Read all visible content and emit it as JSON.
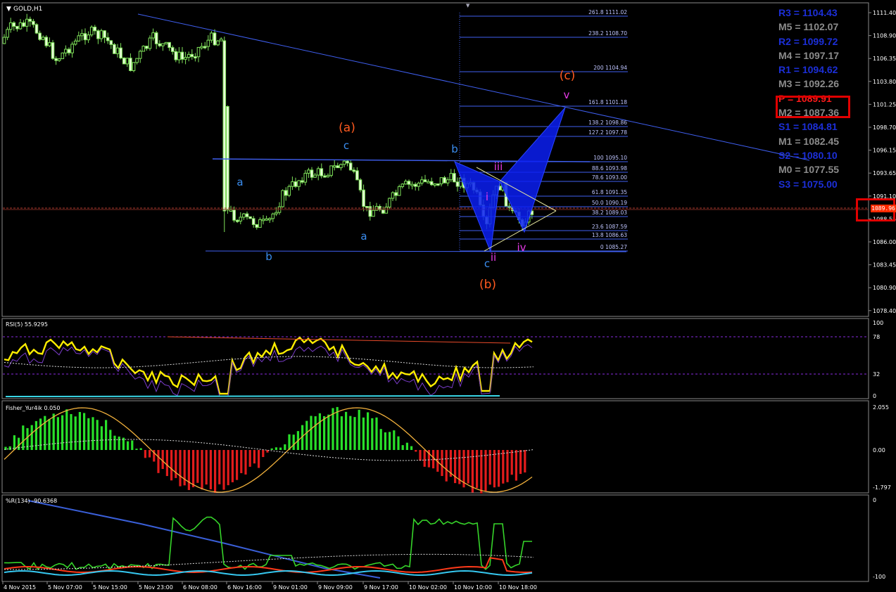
{
  "symbol": "GOLD,H1",
  "price_axis": [
    "1111.40",
    "1108.90",
    "1106.35",
    "1103.80",
    "1101.25",
    "1098.70",
    "1096.15",
    "1093.65",
    "1091.10",
    "1088.55",
    "1086.00",
    "1083.45",
    "1080.90",
    "1078.40"
  ],
  "current_price": "1089.96",
  "pivots": [
    {
      "label": "R3 = 1104.43",
      "color": "blue"
    },
    {
      "label": "M5 = 1102.07",
      "color": "gray"
    },
    {
      "label": "R2 = 1099.72",
      "color": "blue"
    },
    {
      "label": "M4 = 1097.17",
      "color": "gray"
    },
    {
      "label": "R1 = 1094.62",
      "color": "blue"
    },
    {
      "label": "M3 = 1092.26",
      "color": "gray"
    },
    {
      "label": "P  = 1089.91",
      "color": "red"
    },
    {
      "label": "M2 = 1087.36",
      "color": "gray"
    },
    {
      "label": "S1 = 1084.81",
      "color": "blue"
    },
    {
      "label": "M1 = 1082.45",
      "color": "gray"
    },
    {
      "label": "S2 = 1080.10",
      "color": "blue"
    },
    {
      "label": "M0 = 1077.55",
      "color": "gray"
    },
    {
      "label": "S3 = 1075.00",
      "color": "blue"
    }
  ],
  "fib_levels": [
    "261.8 1111.02",
    "238.2 1108.70",
    "200 1104.94",
    "161.8 1101.18",
    "138.2 1098.86",
    "127.2 1097.78",
    "100 1095.10",
    "88.6 1093.98",
    "78.6 1093.00",
    "61.8 1091.35",
    "50.0 1090.19",
    "38.2 1089.03",
    "23.6 1087.59",
    "13.8 1086.63",
    "0 1085.27"
  ],
  "wave_labels": {
    "a1": "a",
    "b1": "b",
    "c1": "c",
    "a2": "a",
    "b2": "b",
    "c2": "c",
    "A": "(a)",
    "B": "(b)",
    "C": "(c)",
    "i": "i",
    "ii": "ii",
    "iii": "iii",
    "iv": "iv",
    "v": "v"
  },
  "rsi": {
    "title": "RSI(5) 55.9295",
    "levels": [
      "100",
      "78",
      "32",
      "0"
    ]
  },
  "fisher": {
    "title": "Fisher_Yur4ik 0.050",
    "levels": [
      "2.055",
      "0.00",
      "-1.797"
    ]
  },
  "wpr": {
    "title": "%R(134) -90.6368",
    "levels": [
      "0",
      "-100"
    ]
  },
  "time_axis": [
    "4 Nov 2015",
    "5 Nov 07:00",
    "5 Nov 15:00",
    "5 Nov 23:00",
    "6 Nov 08:00",
    "6 Nov 16:00",
    "9 Nov 01:00",
    "9 Nov 09:00",
    "9 Nov 17:00",
    "10 Nov 02:00",
    "10 Nov 10:00",
    "10 Nov 18:00"
  ]
}
